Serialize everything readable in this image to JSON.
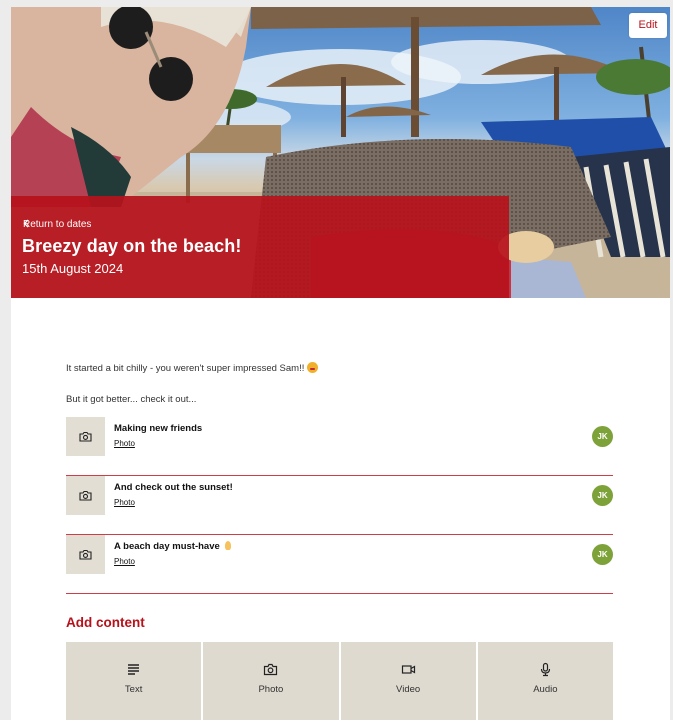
{
  "header": {
    "edit_label": "Edit",
    "back_label": "Return to dates",
    "title": "Breezy day on the beach!",
    "date": "15th August 2024"
  },
  "description": {
    "line1": "It started a bit chilly - you weren't super impressed Sam!!",
    "line2": "But it got better... check it out..."
  },
  "items": [
    {
      "title": "Making new friends",
      "type": "Photo",
      "author_initials": "JK",
      "icon": "camera-icon"
    },
    {
      "title": "And check out the sunset!",
      "type": "Photo",
      "author_initials": "JK",
      "icon": "camera-icon"
    },
    {
      "title": "A beach day must-have",
      "type": "Photo",
      "author_initials": "JK",
      "icon": "camera-icon"
    }
  ],
  "add_content": {
    "heading": "Add content",
    "options": [
      {
        "label": "Text",
        "icon": "text-lines-icon"
      },
      {
        "label": "Photo",
        "icon": "camera-icon"
      },
      {
        "label": "Video",
        "icon": "video-camera-icon"
      },
      {
        "label": "Audio",
        "icon": "microphone-icon"
      }
    ]
  },
  "colors": {
    "brand_red": "#b5121b",
    "divider_red": "#cf3d46",
    "tile_beige": "#dedad0",
    "avatar_green": "#7ea23a"
  }
}
